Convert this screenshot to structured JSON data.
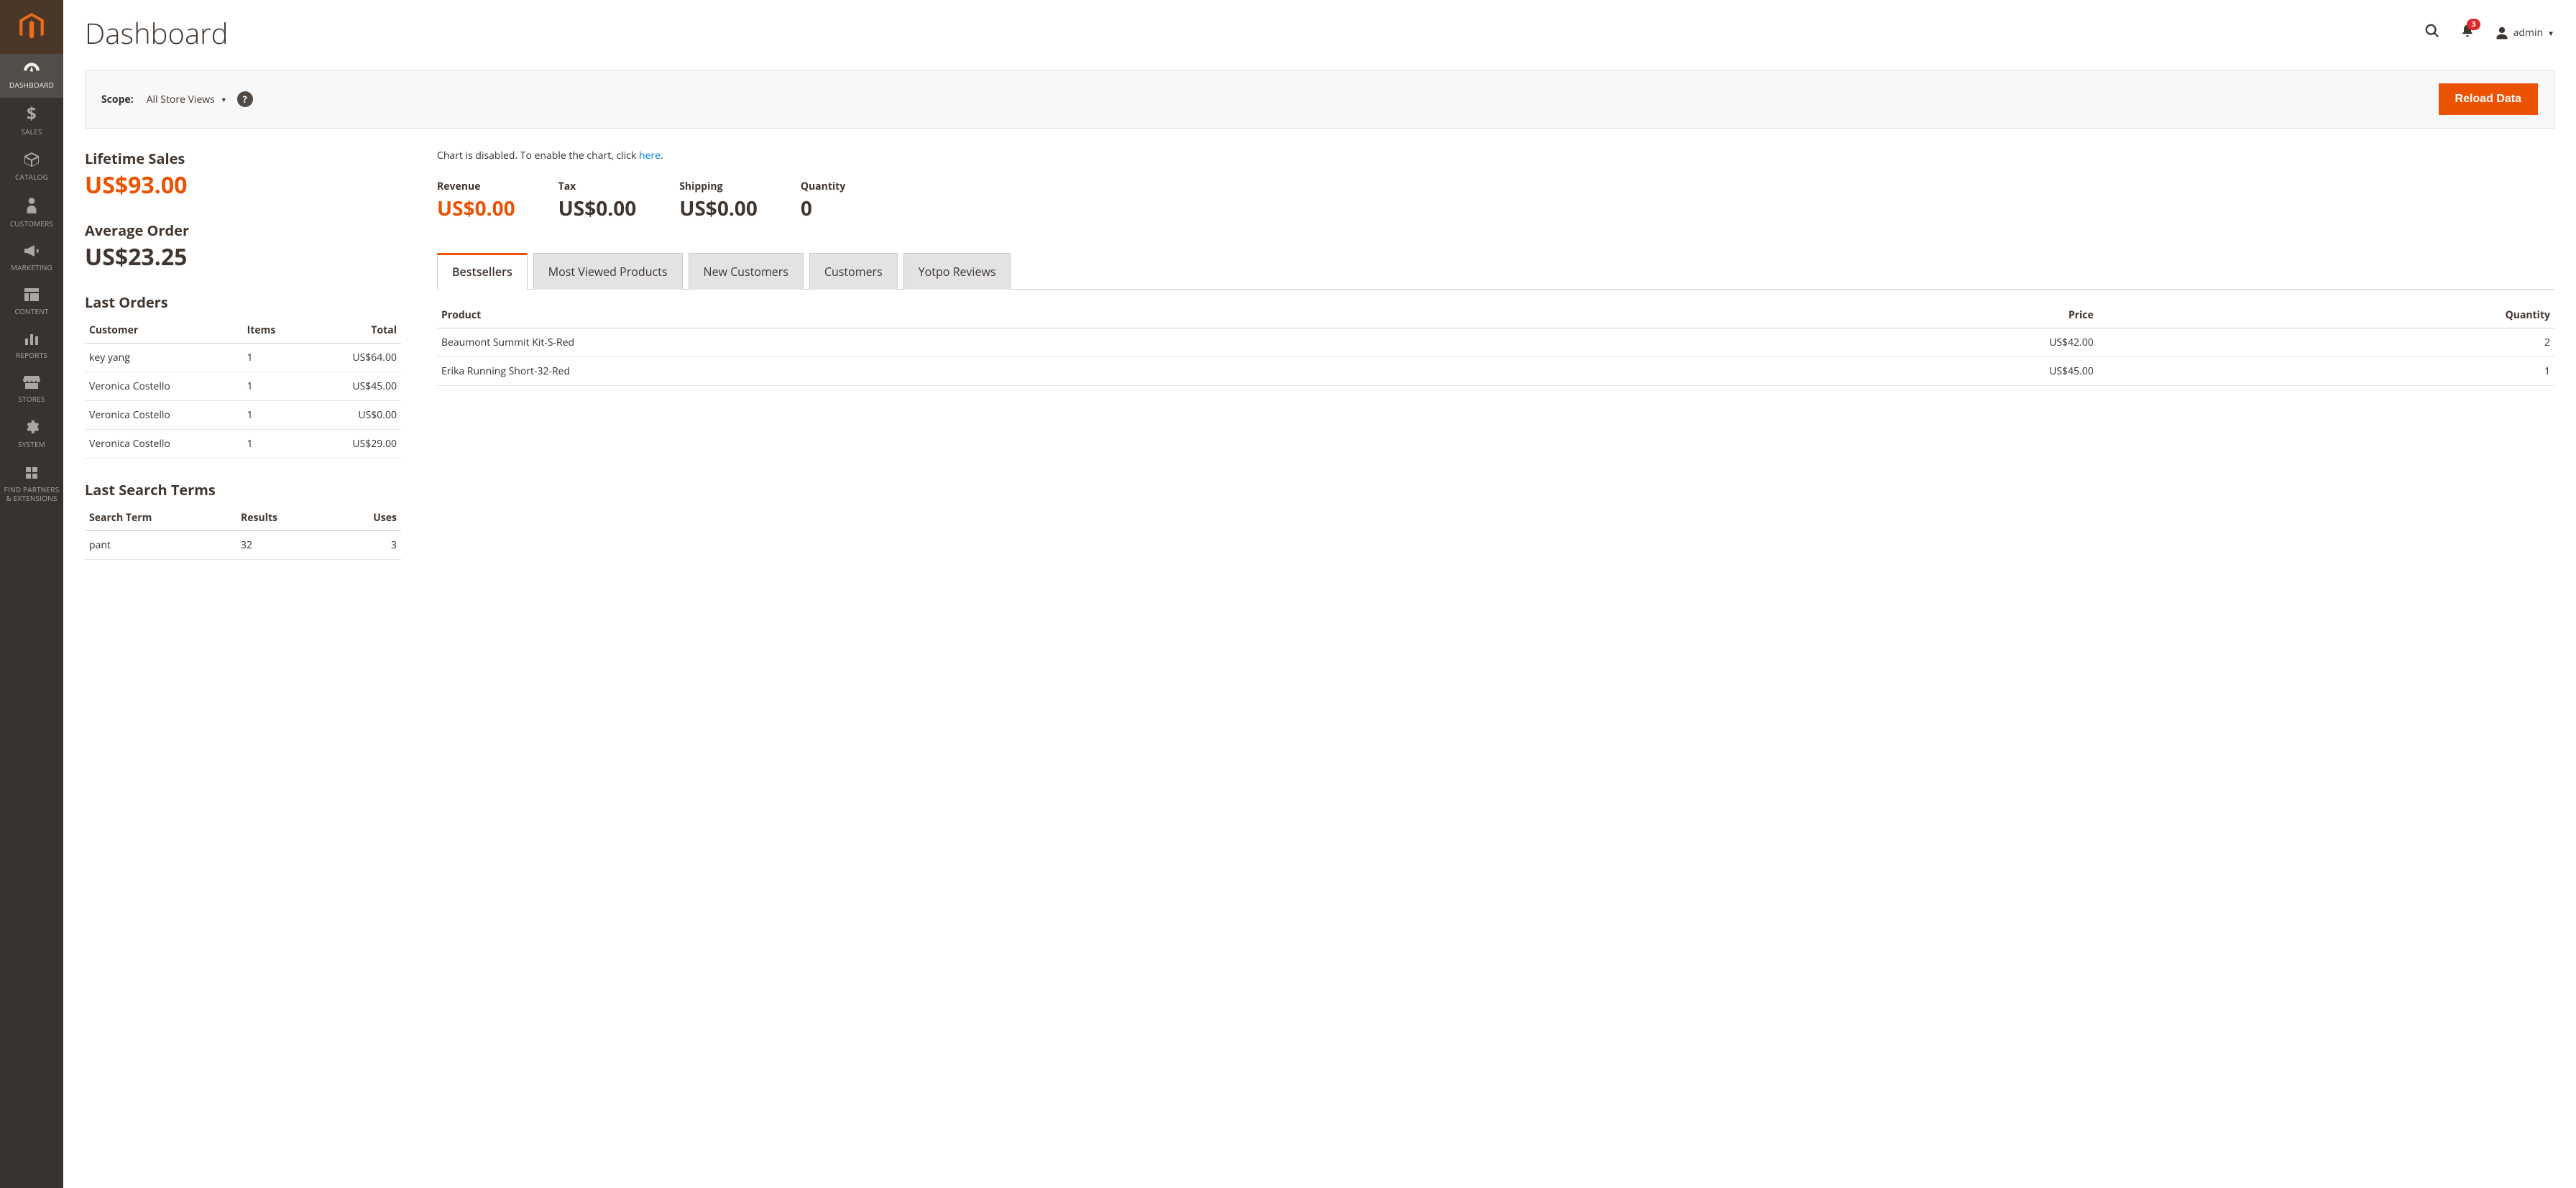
{
  "header": {
    "title": "Dashboard",
    "notif_count": "3",
    "user_label": "admin"
  },
  "nav": [
    {
      "label": "DASHBOARD",
      "icon": "gauge",
      "active": true
    },
    {
      "label": "SALES",
      "icon": "dollar",
      "active": false
    },
    {
      "label": "CATALOG",
      "icon": "cube",
      "active": false
    },
    {
      "label": "CUSTOMERS",
      "icon": "person",
      "active": false
    },
    {
      "label": "MARKETING",
      "icon": "megaphone",
      "active": false
    },
    {
      "label": "CONTENT",
      "icon": "layout",
      "active": false
    },
    {
      "label": "REPORTS",
      "icon": "bars",
      "active": false
    },
    {
      "label": "STORES",
      "icon": "storefront",
      "active": false
    },
    {
      "label": "SYSTEM",
      "icon": "gear",
      "active": false
    },
    {
      "label": "FIND PARTNERS & EXTENSIONS",
      "icon": "partners",
      "active": false
    }
  ],
  "scope": {
    "label": "Scope:",
    "value": "All Store Views",
    "reload_label": "Reload Data"
  },
  "stats": {
    "lifetime_label": "Lifetime Sales",
    "lifetime_value": "US$93.00",
    "avg_label": "Average Order",
    "avg_value": "US$23.25"
  },
  "last_orders": {
    "title": "Last Orders",
    "cols": {
      "customer": "Customer",
      "items": "Items",
      "total": "Total"
    },
    "rows": [
      {
        "customer": "key yang",
        "items": "1",
        "total": "US$64.00"
      },
      {
        "customer": "Veronica Costello",
        "items": "1",
        "total": "US$45.00"
      },
      {
        "customer": "Veronica Costello",
        "items": "1",
        "total": "US$0.00"
      },
      {
        "customer": "Veronica Costello",
        "items": "1",
        "total": "US$29.00"
      }
    ]
  },
  "last_search": {
    "title": "Last Search Terms",
    "cols": {
      "term": "Search Term",
      "results": "Results",
      "uses": "Uses"
    },
    "rows": [
      {
        "term": "pant",
        "results": "32",
        "uses": "3"
      }
    ]
  },
  "chart_note": {
    "prefix": "Chart is disabled. To enable the chart, click ",
    "link": "here",
    "suffix": "."
  },
  "totals": {
    "revenue": {
      "label": "Revenue",
      "value": "US$0.00"
    },
    "tax": {
      "label": "Tax",
      "value": "US$0.00"
    },
    "shipping": {
      "label": "Shipping",
      "value": "US$0.00"
    },
    "quantity": {
      "label": "Quantity",
      "value": "0"
    }
  },
  "tabs": [
    {
      "label": "Bestsellers",
      "active": true
    },
    {
      "label": "Most Viewed Products",
      "active": false
    },
    {
      "label": "New Customers",
      "active": false
    },
    {
      "label": "Customers",
      "active": false
    },
    {
      "label": "Yotpo Reviews",
      "active": false
    }
  ],
  "bestsellers": {
    "cols": {
      "product": "Product",
      "price": "Price",
      "quantity": "Quantity"
    },
    "rows": [
      {
        "product": "Beaumont Summit Kit-S-Red",
        "price": "US$42.00",
        "quantity": "2"
      },
      {
        "product": "Erika Running Short-32-Red",
        "price": "US$45.00",
        "quantity": "1"
      }
    ]
  }
}
